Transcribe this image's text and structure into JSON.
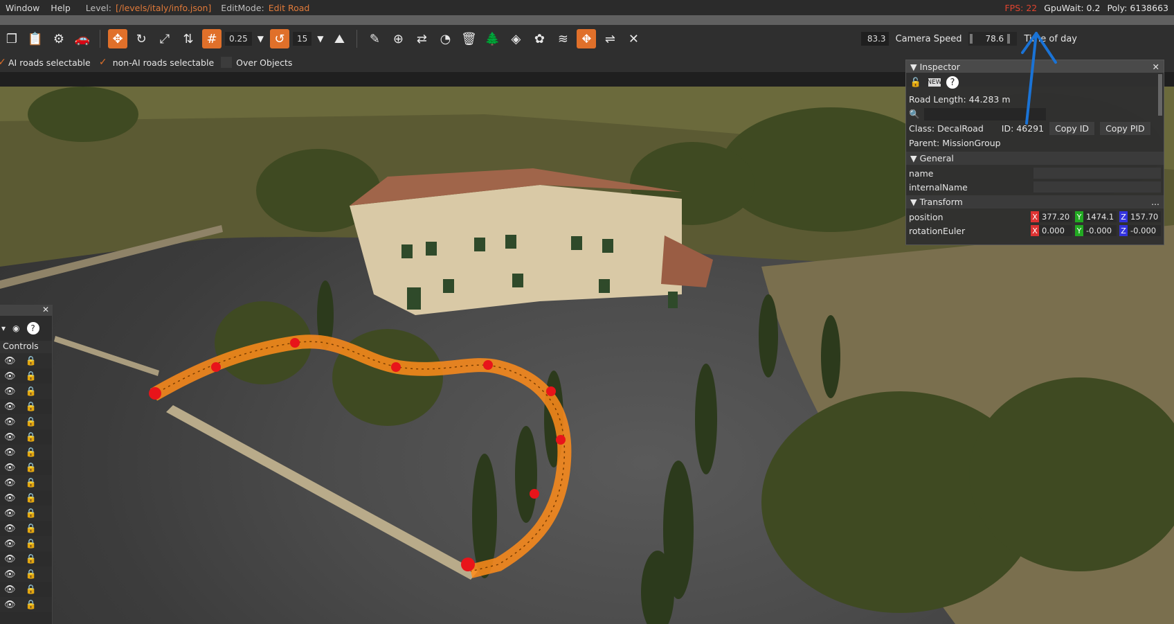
{
  "menubar": {
    "items": [
      "Window",
      "Help"
    ],
    "level_label": "Level:",
    "level_value": "[/levels/italy/info.json]",
    "editmode_label": "EditMode:",
    "editmode_value": "Edit Road",
    "fps": "FPS: 22",
    "gpuwait": "GpuWait: 0.2",
    "poly": "Poly: 6138663"
  },
  "toolbar": {
    "grid_value": "0.25",
    "rotate_value": "15",
    "camera_speed_value": "83.3",
    "camera_speed_label": "Camera Speed",
    "time_of_day_value": "78.6",
    "time_of_day_label": "Time of day"
  },
  "options": {
    "ai_roads": "AI roads selectable",
    "non_ai_roads": "non-AI roads selectable",
    "over_objects": "Over Objects"
  },
  "inspector": {
    "title": "Inspector",
    "road_length": "Road Length: 44.283 m",
    "class_label": "Class:",
    "class_value": "DecalRoad",
    "id_label": "ID:",
    "id_value": "46291",
    "copy_id": "Copy ID",
    "copy_pid": "Copy PID",
    "parent_label": "Parent:",
    "parent_value": "MissionGroup",
    "general": "General",
    "name": "name",
    "internal_name": "internalName",
    "transform": "Transform",
    "more": "...",
    "position": "position",
    "position_x": "377.20",
    "position_y": "1474.1",
    "position_z": "157.70",
    "rotation": "rotationEuler",
    "rotation_x": "0.000",
    "rotation_y": "-0.000",
    "rotation_z": "-0.000"
  },
  "leftpanel": {
    "header": "Controls",
    "rows": 17
  },
  "colors": {
    "accent": "#e0702a",
    "fps": "#e0442f",
    "annotation": "#1a73d6"
  }
}
